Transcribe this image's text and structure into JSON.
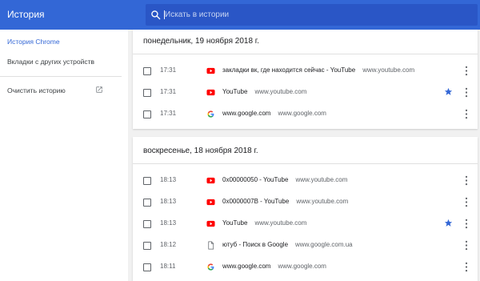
{
  "header": {
    "title": "История",
    "search_placeholder": "Искать в истории"
  },
  "sidebar": {
    "items": [
      {
        "label": "История Chrome"
      },
      {
        "label": "Вкладки с других устройств"
      },
      {
        "label": "Очистить историю"
      }
    ]
  },
  "groups": [
    {
      "date": "понедельник, 19 ноября 2018 г.",
      "entries": [
        {
          "time": "17:31",
          "icon": "youtube-icon",
          "title": "закладки вк, где находится сейчас - YouTube",
          "domain": "www.youtube.com",
          "starred": false
        },
        {
          "time": "17:31",
          "icon": "youtube-icon",
          "title": "YouTube",
          "domain": "www.youtube.com",
          "starred": true
        },
        {
          "time": "17:31",
          "icon": "google-icon",
          "title": "www.google.com",
          "domain": "www.google.com",
          "starred": false
        }
      ]
    },
    {
      "date": "воскресенье, 18 ноября 2018 г.",
      "entries": [
        {
          "time": "18:13",
          "icon": "youtube-icon",
          "title": "0x00000050 - YouTube",
          "domain": "www.youtube.com",
          "starred": false
        },
        {
          "time": "18:13",
          "icon": "youtube-icon",
          "title": "0x0000007B - YouTube",
          "domain": "www.youtube.com",
          "starred": false
        },
        {
          "time": "18:13",
          "icon": "youtube-icon",
          "title": "YouTube",
          "domain": "www.youtube.com",
          "starred": true
        },
        {
          "time": "18:12",
          "icon": "page-icon",
          "title": "ютуб - Поиск в Google",
          "domain": "www.google.com.ua",
          "starred": false
        },
        {
          "time": "18:11",
          "icon": "google-icon",
          "title": "www.google.com",
          "domain": "www.google.com",
          "starred": false
        }
      ]
    }
  ],
  "colors": {
    "header_bg": "#3367d6",
    "accent": "#3367d6",
    "youtube_red": "#ff0000"
  }
}
